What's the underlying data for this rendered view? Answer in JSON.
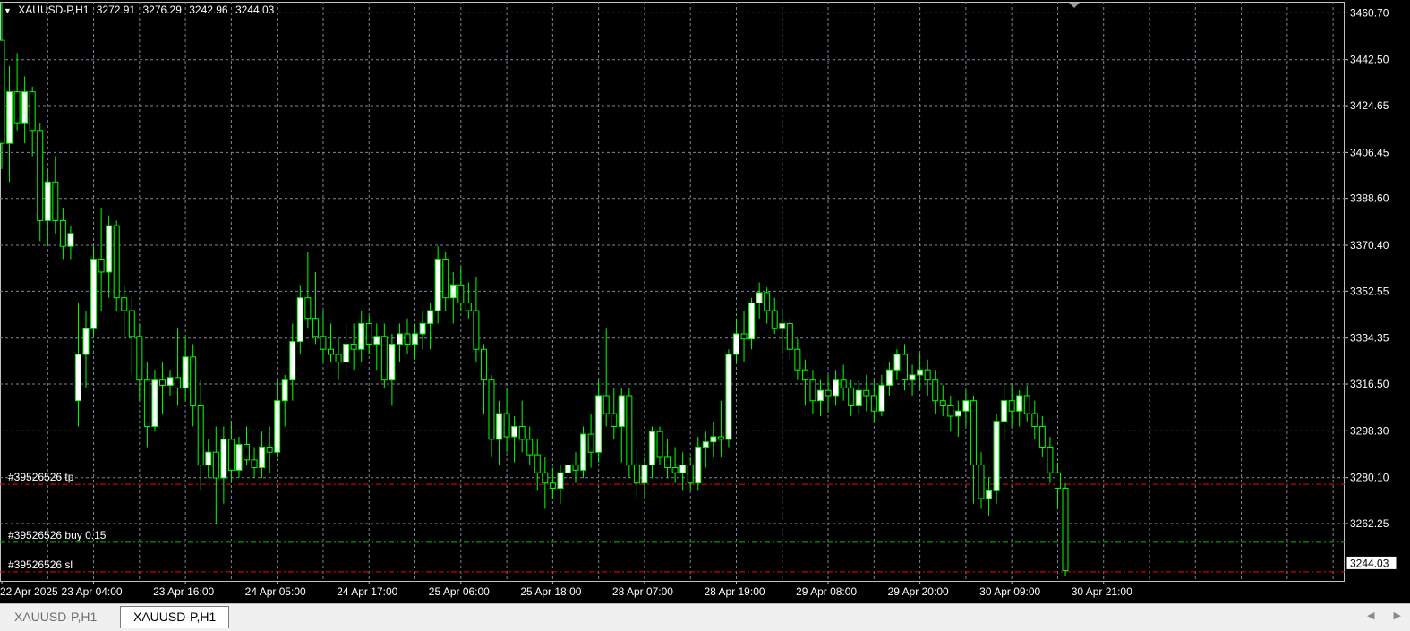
{
  "header": {
    "symbol": "XAUUSD-P,H1",
    "open": "3272.91",
    "high": "3276.29",
    "low": "3242.96",
    "close": "3244.03"
  },
  "tabs": [
    {
      "label": "XAUUSD-P,H1",
      "active": false
    },
    {
      "label": "XAUUSD-P,H1",
      "active": true
    }
  ],
  "chart_data": {
    "type": "candlestick",
    "grid": true,
    "y_ticks": [
      "3460.70",
      "3442.50",
      "3424.65",
      "3406.45",
      "3388.60",
      "3370.40",
      "3352.55",
      "3334.35",
      "3316.50",
      "3298.30",
      "3280.10",
      "3262.25"
    ],
    "y_range": [
      3240,
      3465
    ],
    "current_price": "3244.03",
    "x_ticks": [
      "22 Apr 2025",
      "23 Apr 04:00",
      "23 Apr 16:00",
      "24 Apr 05:00",
      "24 Apr 17:00",
      "25 Apr 06:00",
      "25 Apr 18:00",
      "28 Apr 07:00",
      "28 Apr 19:00",
      "29 Apr 08:00",
      "29 Apr 20:00",
      "30 Apr 09:00",
      "30 Apr 21:00"
    ],
    "candles": [
      [
        3450,
        3465,
        3400,
        3410
      ],
      [
        3410,
        3440,
        3395,
        3430
      ],
      [
        3430,
        3445,
        3415,
        3418
      ],
      [
        3418,
        3436,
        3410,
        3430
      ],
      [
        3430,
        3432,
        3405,
        3415
      ],
      [
        3415,
        3418,
        3372,
        3380
      ],
      [
        3380,
        3400,
        3370,
        3395
      ],
      [
        3395,
        3405,
        3375,
        3380
      ],
      [
        3380,
        3385,
        3365,
        3370
      ],
      [
        3370,
        3378,
        3365,
        3375
      ],
      [
        3310,
        3348,
        3300,
        3328
      ],
      [
        3328,
        3345,
        3315,
        3338
      ],
      [
        3338,
        3370,
        3335,
        3365
      ],
      [
        3365,
        3385,
        3345,
        3360
      ],
      [
        3360,
        3382,
        3350,
        3378
      ],
      [
        3378,
        3380,
        3345,
        3350
      ],
      [
        3350,
        3355,
        3335,
        3345
      ],
      [
        3345,
        3350,
        3320,
        3335
      ],
      [
        3335,
        3340,
        3310,
        3318
      ],
      [
        3318,
        3325,
        3292,
        3300
      ],
      [
        3300,
        3322,
        3298,
        3318
      ],
      [
        3318,
        3325,
        3305,
        3316
      ],
      [
        3316,
        3322,
        3312,
        3319
      ],
      [
        3319,
        3338,
        3308,
        3315
      ],
      [
        3315,
        3335,
        3310,
        3327
      ],
      [
        3327,
        3332,
        3300,
        3308
      ],
      [
        3308,
        3318,
        3275,
        3285
      ],
      [
        3285,
        3295,
        3280,
        3290
      ],
      [
        3290,
        3300,
        3262,
        3280
      ],
      [
        3280,
        3300,
        3270,
        3295
      ],
      [
        3295,
        3302,
        3278,
        3283
      ],
      [
        3283,
        3296,
        3280,
        3293
      ],
      [
        3293,
        3300,
        3285,
        3287
      ],
      [
        3287,
        3292,
        3280,
        3284
      ],
      [
        3284,
        3298,
        3280,
        3292
      ],
      [
        3292,
        3300,
        3282,
        3290
      ],
      [
        3290,
        3318,
        3288,
        3310
      ],
      [
        3310,
        3320,
        3300,
        3318
      ],
      [
        3318,
        3340,
        3310,
        3333
      ],
      [
        3333,
        3355,
        3328,
        3350
      ],
      [
        3350,
        3368,
        3338,
        3342
      ],
      [
        3342,
        3360,
        3332,
        3335
      ],
      [
        3335,
        3345,
        3325,
        3330
      ],
      [
        3330,
        3340,
        3325,
        3328
      ],
      [
        3328,
        3334,
        3318,
        3325
      ],
      [
        3325,
        3340,
        3320,
        3332
      ],
      [
        3332,
        3340,
        3322,
        3330
      ],
      [
        3330,
        3345,
        3325,
        3340
      ],
      [
        3340,
        3343,
        3328,
        3332
      ],
      [
        3332,
        3340,
        3322,
        3335
      ],
      [
        3335,
        3340,
        3315,
        3318
      ],
      [
        3318,
        3336,
        3308,
        3332
      ],
      [
        3332,
        3340,
        3325,
        3336
      ],
      [
        3336,
        3342,
        3328,
        3332
      ],
      [
        3332,
        3340,
        3326,
        3336
      ],
      [
        3336,
        3345,
        3330,
        3340
      ],
      [
        3340,
        3348,
        3330,
        3345
      ],
      [
        3345,
        3370,
        3340,
        3365
      ],
      [
        3365,
        3368,
        3345,
        3350
      ],
      [
        3350,
        3360,
        3340,
        3355
      ],
      [
        3355,
        3362,
        3345,
        3348
      ],
      [
        3348,
        3356,
        3342,
        3345
      ],
      [
        3345,
        3358,
        3325,
        3330
      ],
      [
        3330,
        3332,
        3305,
        3318
      ],
      [
        3318,
        3320,
        3288,
        3295
      ],
      [
        3295,
        3310,
        3285,
        3305
      ],
      [
        3305,
        3315,
        3290,
        3296
      ],
      [
        3296,
        3304,
        3286,
        3300
      ],
      [
        3300,
        3310,
        3290,
        3295
      ],
      [
        3295,
        3300,
        3285,
        3289
      ],
      [
        3289,
        3295,
        3275,
        3282
      ],
      [
        3282,
        3288,
        3268,
        3278
      ],
      [
        3278,
        3284,
        3272,
        3276
      ],
      [
        3276,
        3285,
        3270,
        3282
      ],
      [
        3282,
        3290,
        3275,
        3285
      ],
      [
        3285,
        3290,
        3278,
        3283
      ],
      [
        3283,
        3300,
        3280,
        3297
      ],
      [
        3297,
        3305,
        3284,
        3290
      ],
      [
        3290,
        3318,
        3286,
        3312
      ],
      [
        3312,
        3338,
        3300,
        3305
      ],
      [
        3305,
        3315,
        3295,
        3300
      ],
      [
        3300,
        3315,
        3286,
        3312
      ],
      [
        3312,
        3315,
        3280,
        3285
      ],
      [
        3285,
        3292,
        3272,
        3278
      ],
      [
        3278,
        3288,
        3272,
        3285
      ],
      [
        3285,
        3300,
        3280,
        3298
      ],
      [
        3298,
        3300,
        3285,
        3288
      ],
      [
        3288,
        3295,
        3280,
        3284
      ],
      [
        3284,
        3292,
        3278,
        3282
      ],
      [
        3282,
        3290,
        3275,
        3285
      ],
      [
        3285,
        3288,
        3275,
        3278
      ],
      [
        3278,
        3296,
        3275,
        3292
      ],
      [
        3292,
        3298,
        3284,
        3294
      ],
      [
        3294,
        3302,
        3288,
        3296
      ],
      [
        3296,
        3310,
        3288,
        3295
      ],
      [
        3295,
        3330,
        3292,
        3328
      ],
      [
        3328,
        3342,
        3325,
        3336
      ],
      [
        3336,
        3345,
        3325,
        3334
      ],
      [
        3334,
        3350,
        3330,
        3348
      ],
      [
        3348,
        3356,
        3342,
        3352
      ],
      [
        3352,
        3354,
        3340,
        3345
      ],
      [
        3345,
        3350,
        3336,
        3338
      ],
      [
        3338,
        3345,
        3328,
        3340
      ],
      [
        3340,
        3342,
        3326,
        3330
      ],
      [
        3330,
        3334,
        3318,
        3322
      ],
      [
        3322,
        3326,
        3308,
        3318
      ],
      [
        3318,
        3322,
        3305,
        3310
      ],
      [
        3310,
        3318,
        3304,
        3314
      ],
      [
        3314,
        3320,
        3306,
        3312
      ],
      [
        3312,
        3322,
        3308,
        3318
      ],
      [
        3318,
        3324,
        3310,
        3315
      ],
      [
        3315,
        3318,
        3304,
        3308
      ],
      [
        3308,
        3318,
        3305,
        3314
      ],
      [
        3314,
        3320,
        3306,
        3312
      ],
      [
        3312,
        3318,
        3302,
        3306
      ],
      [
        3306,
        3320,
        3304,
        3316
      ],
      [
        3316,
        3325,
        3312,
        3322
      ],
      [
        3322,
        3330,
        3318,
        3328
      ],
      [
        3328,
        3332,
        3314,
        3318
      ],
      [
        3318,
        3324,
        3312,
        3320
      ],
      [
        3320,
        3328,
        3314,
        3322
      ],
      [
        3322,
        3326,
        3312,
        3318
      ],
      [
        3318,
        3322,
        3305,
        3310
      ],
      [
        3310,
        3316,
        3304,
        3308
      ],
      [
        3308,
        3312,
        3298,
        3304
      ],
      [
        3304,
        3310,
        3296,
        3306
      ],
      [
        3306,
        3314,
        3300,
        3310
      ],
      [
        3310,
        3312,
        3270,
        3285
      ],
      [
        3285,
        3290,
        3268,
        3272
      ],
      [
        3272,
        3280,
        3265,
        3275
      ],
      [
        3275,
        3305,
        3270,
        3302
      ],
      [
        3302,
        3318,
        3295,
        3310
      ],
      [
        3310,
        3316,
        3300,
        3306
      ],
      [
        3306,
        3314,
        3300,
        3312
      ],
      [
        3312,
        3316,
        3302,
        3305
      ],
      [
        3305,
        3310,
        3295,
        3300
      ],
      [
        3300,
        3304,
        3288,
        3292
      ],
      [
        3292,
        3296,
        3278,
        3282
      ],
      [
        3282,
        3286,
        3268,
        3276
      ],
      [
        3276,
        3278,
        3242,
        3244
      ]
    ],
    "levels": [
      {
        "label": "#39526526 tp",
        "price": 3277.5,
        "color": "#ff0000"
      },
      {
        "label": "#39526526 buy 0.15",
        "price": 3255.0,
        "color": "#00c000"
      },
      {
        "label": "#39526526 sl",
        "price": 3243.5,
        "color": "#ff0000"
      }
    ],
    "colors": {
      "bull_body": "#ffffff",
      "bear_body": "#000000",
      "candle_outline": "#00ff00",
      "grid": "#7a8a99",
      "axis_text": "#ffffff"
    }
  }
}
